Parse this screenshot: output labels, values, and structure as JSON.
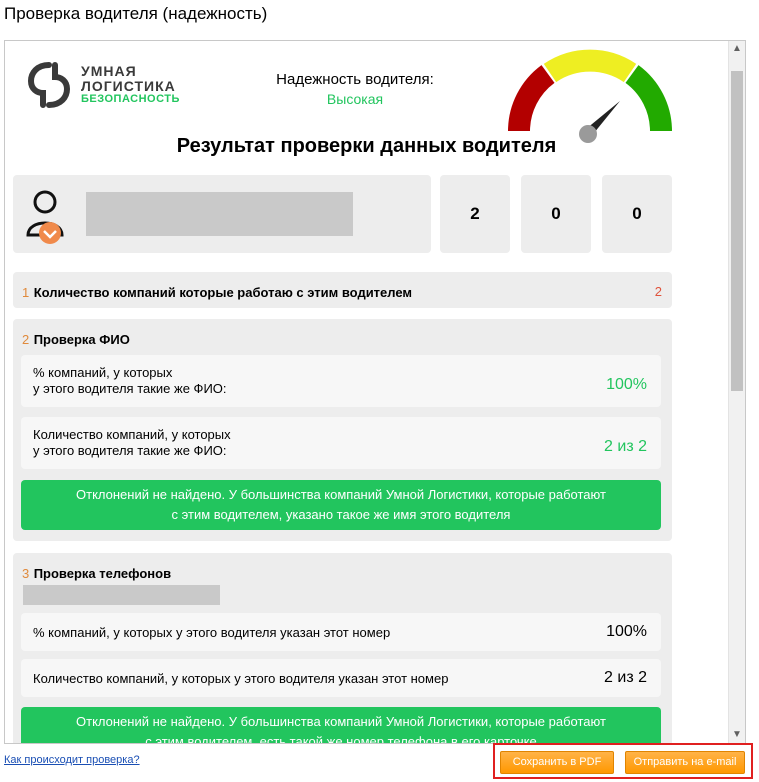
{
  "window": {
    "title": "Проверка водителя (надежность)"
  },
  "logo": {
    "line1": "УМНАЯ",
    "line2": "ЛОГИСТИКА",
    "line3": "БЕЗОПАСНОСТЬ"
  },
  "reliability": {
    "label": "Надежность водителя:",
    "value": "Высокая"
  },
  "gauge": {
    "segments": [
      "#b30000",
      "#eeee22",
      "#22aa00"
    ],
    "level": 0.78
  },
  "heading": "Результат проверки данных водителя",
  "stats": [
    "2",
    "0",
    "0"
  ],
  "section1": {
    "num": "1",
    "title": "Количество компаний которые работаю с этим водителем",
    "count": "2"
  },
  "section2": {
    "num": "2",
    "title": "Проверка ФИО",
    "rows": [
      {
        "line1": "% компаний, у которых",
        "line2": "у этого водителя такие же ФИО:",
        "value": "100%"
      },
      {
        "line1": "Количество компаний, у которых",
        "line2": "у этого водителя такие же ФИО:",
        "value": "2 из 2"
      }
    ],
    "note_line1": "Отклонений не найдено. У большинства компаний Умной Логистики, которые работают",
    "note_line2": "с этим водителем, указано такое же имя этого водителя"
  },
  "section3": {
    "num": "3",
    "title": "Проверка телефонов",
    "rows": [
      {
        "label": "% компаний, у которых у этого водителя указан этот номер",
        "value": "100%"
      },
      {
        "label": "Количество компаний, у которых у этого водителя указан этот номер",
        "value": "2 из 2"
      }
    ],
    "note_line1": "Отклонений не найдено. У большинства компаний Умной Логистики, которые работают",
    "note_line2": "с этим водителем, есть такой же номер телефона в его карточке"
  },
  "footer": {
    "help_link": "Как происходит проверка?",
    "save_pdf": "Сохранить в PDF",
    "send_email": "Отправить на e-mail"
  }
}
